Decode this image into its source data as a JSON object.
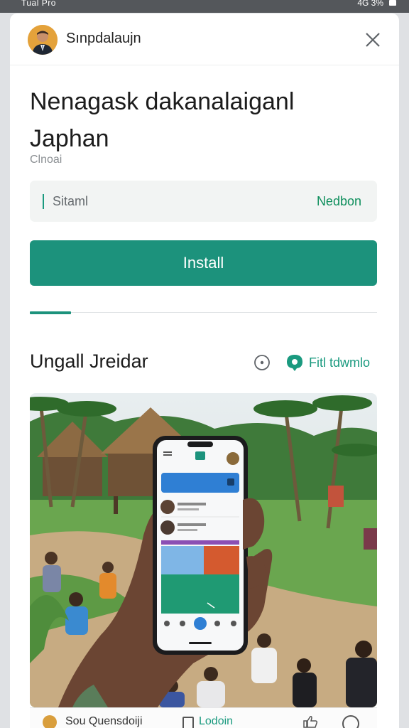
{
  "status_bar": {
    "left_text": "Tual Pro",
    "right_text": "4G 3%",
    "time": ""
  },
  "header": {
    "app_name": "Sınpdalaujn"
  },
  "content": {
    "title": "Nenagask dakanalaiganl Japhan",
    "subtitle": "Clnoai",
    "field": {
      "value": "Sitaml",
      "action_label": "Nedbon"
    },
    "install_button": "Install",
    "section_title": "Ungall Jreidar",
    "share_label": "Fitl tdwmlo"
  },
  "footer": {
    "label": "Sou Quensdoiji",
    "label_2": "Lodoin"
  },
  "colors": {
    "accent": "#1c927c",
    "accent_text": "#0f8f5d",
    "status_bar": "#54575b"
  },
  "icons": [
    "avatar",
    "close-icon",
    "info-icon",
    "share-icon",
    "phone-screen"
  ]
}
